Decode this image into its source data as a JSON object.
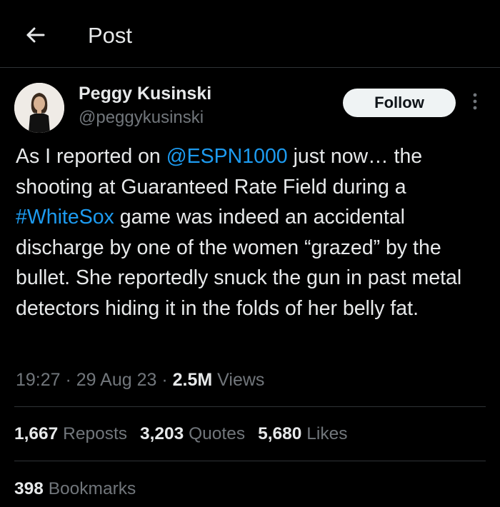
{
  "header": {
    "title": "Post"
  },
  "author": {
    "name": "Peggy Kusinski",
    "handle": "@peggykusinski"
  },
  "follow_label": "Follow",
  "tweet": {
    "part1": "As I reported on ",
    "mention": "@ESPN1000",
    "part2": " just now… the shooting at Guaranteed Rate Field during a ",
    "hashtag": "#WhiteSox",
    "part3": " game was indeed an accidental discharge by one of the women “grazed” by the bullet.  She reportedly snuck the gun in past metal detectors hiding it in the folds of her belly fat."
  },
  "meta": {
    "time": "19:27",
    "sep1": " · ",
    "date": "29 Aug 23",
    "sep2": " · ",
    "views_count": "2.5M",
    "views_label": " Views"
  },
  "stats": {
    "reposts_count": "1,667",
    "reposts_label": " Reposts",
    "quotes_count": "3,203",
    "quotes_label": " Quotes",
    "likes_count": "5,680",
    "likes_label": " Likes",
    "bookmarks_count": "398",
    "bookmarks_label": " Bookmarks"
  },
  "icons": {
    "back": "arrow-left-icon",
    "more": "more-vertical-icon"
  },
  "colors": {
    "background": "#000000",
    "text": "#e7e9ea",
    "secondary_text": "#71767b",
    "link": "#1d9bf0",
    "divider": "#2f3336",
    "follow_bg": "#eff3f4"
  }
}
